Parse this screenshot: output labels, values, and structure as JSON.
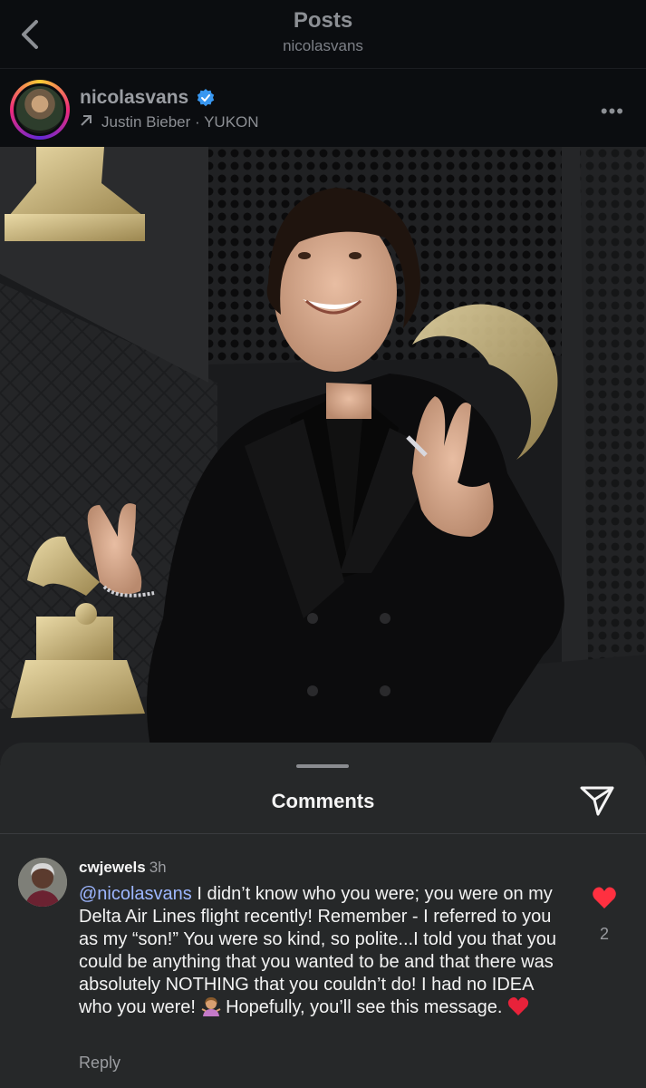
{
  "header": {
    "title": "Posts",
    "subtitle": "nicolasvans",
    "back_icon": "chevron-left-icon"
  },
  "post": {
    "username": "nicolasvans",
    "verified": true,
    "music_icon": "arrow-up-right-icon",
    "music_text": "Justin Bieber · YUKON",
    "more_icon": "more-horizontal-icon",
    "more_label": "•••"
  },
  "comments_sheet": {
    "title": "Comments",
    "share_icon": "paper-plane-icon"
  },
  "comments": [
    {
      "username": "cwjewels",
      "time": "3h",
      "mention": "@nicolasvans",
      "text_part1": " I didn’t know who you were; you were on my Delta Air Lines flight recently! Remember - I referred to you as my “son!” You were so kind, so polite...I told you that you could be anything that you wanted to be and that there was absolutely NOTHING that you couldn’t do! I had no IDEA who you were! ",
      "emoji1": "woman-shrugging-emoji",
      "text_part2": " Hopefully, you’ll see this message. ",
      "emoji2": "red-heart-emoji",
      "liked": true,
      "like_count": "2",
      "reply_label": "Reply"
    }
  ],
  "colors": {
    "mention": "#9db6ff",
    "like_heart": "#ff3040",
    "sheet_bg": "#262829"
  }
}
